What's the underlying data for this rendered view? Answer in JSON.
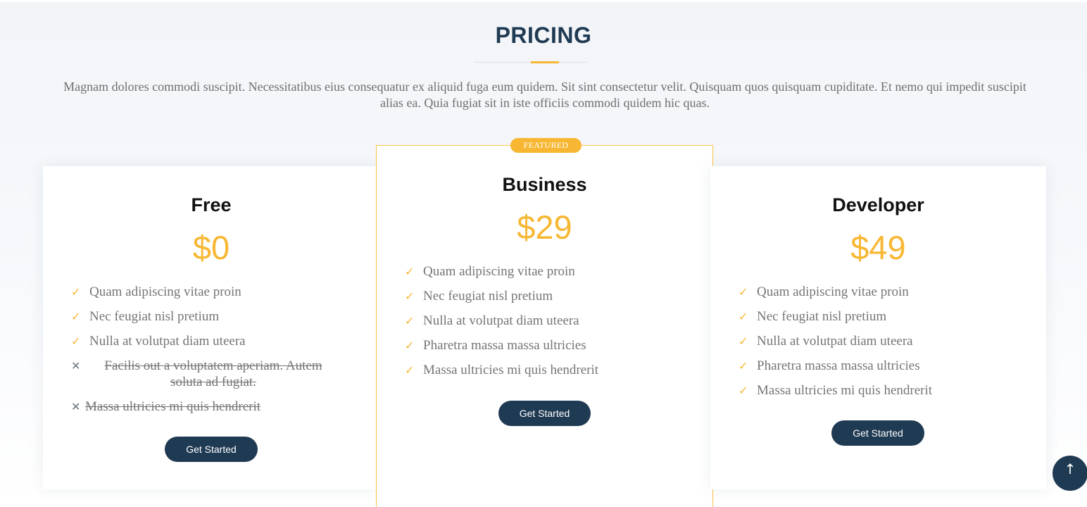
{
  "section": {
    "title": "PRICING",
    "description": "Magnam dolores commodi suscipit. Necessitatibus eius consequatur ex aliquid fuga eum quidem. Sit sint consectetur velit. Quisquam quos quisquam cupiditate. Et nemo qui impedit suscipit alias ea. Quia fugiat sit in iste officiis commodi quidem hic quas."
  },
  "colors": {
    "accent": "#f7b733",
    "dark": "#1f3a53",
    "text": "#757575"
  },
  "plans": [
    {
      "name": "Free",
      "price": "$0",
      "features": [
        {
          "text": "Quam adipiscing vitae proin",
          "included": true
        },
        {
          "text": "Nec feugiat nisl pretium",
          "included": true
        },
        {
          "text": "Nulla at volutpat diam uteera",
          "included": true
        },
        {
          "text": "Facilis out a voluptatem aperiam. Autem soluta ad fugiat.",
          "included": false
        },
        {
          "text": "Massa ultricies mi quis hendrerit",
          "included": false
        }
      ],
      "button": "Get Started"
    },
    {
      "name": "Business",
      "price": "$29",
      "badge": "FEATURED",
      "features": [
        {
          "text": "Quam adipiscing vitae proin",
          "included": true
        },
        {
          "text": "Nec feugiat nisl pretium",
          "included": true
        },
        {
          "text": "Nulla at volutpat diam uteera",
          "included": true
        },
        {
          "text": "Pharetra massa massa ultricies",
          "included": true
        },
        {
          "text": "Massa ultricies mi quis hendrerit",
          "included": true
        }
      ],
      "button": "Get Started"
    },
    {
      "name": "Developer",
      "price": "$49",
      "features": [
        {
          "text": "Quam adipiscing vitae proin",
          "included": true
        },
        {
          "text": "Nec feugiat nisl pretium",
          "included": true
        },
        {
          "text": "Nulla at volutpat diam uteera",
          "included": true
        },
        {
          "text": "Pharetra massa massa ultricies",
          "included": true
        },
        {
          "text": "Massa ultricies mi quis hendrerit",
          "included": true
        }
      ],
      "button": "Get Started"
    }
  ],
  "icons": {
    "included": "check-icon",
    "excluded": "x-icon",
    "back_to_top": "arrow-up-icon",
    "check_glyph": "✓",
    "x_glyph": "✕",
    "arrow_glyph": "↑"
  }
}
